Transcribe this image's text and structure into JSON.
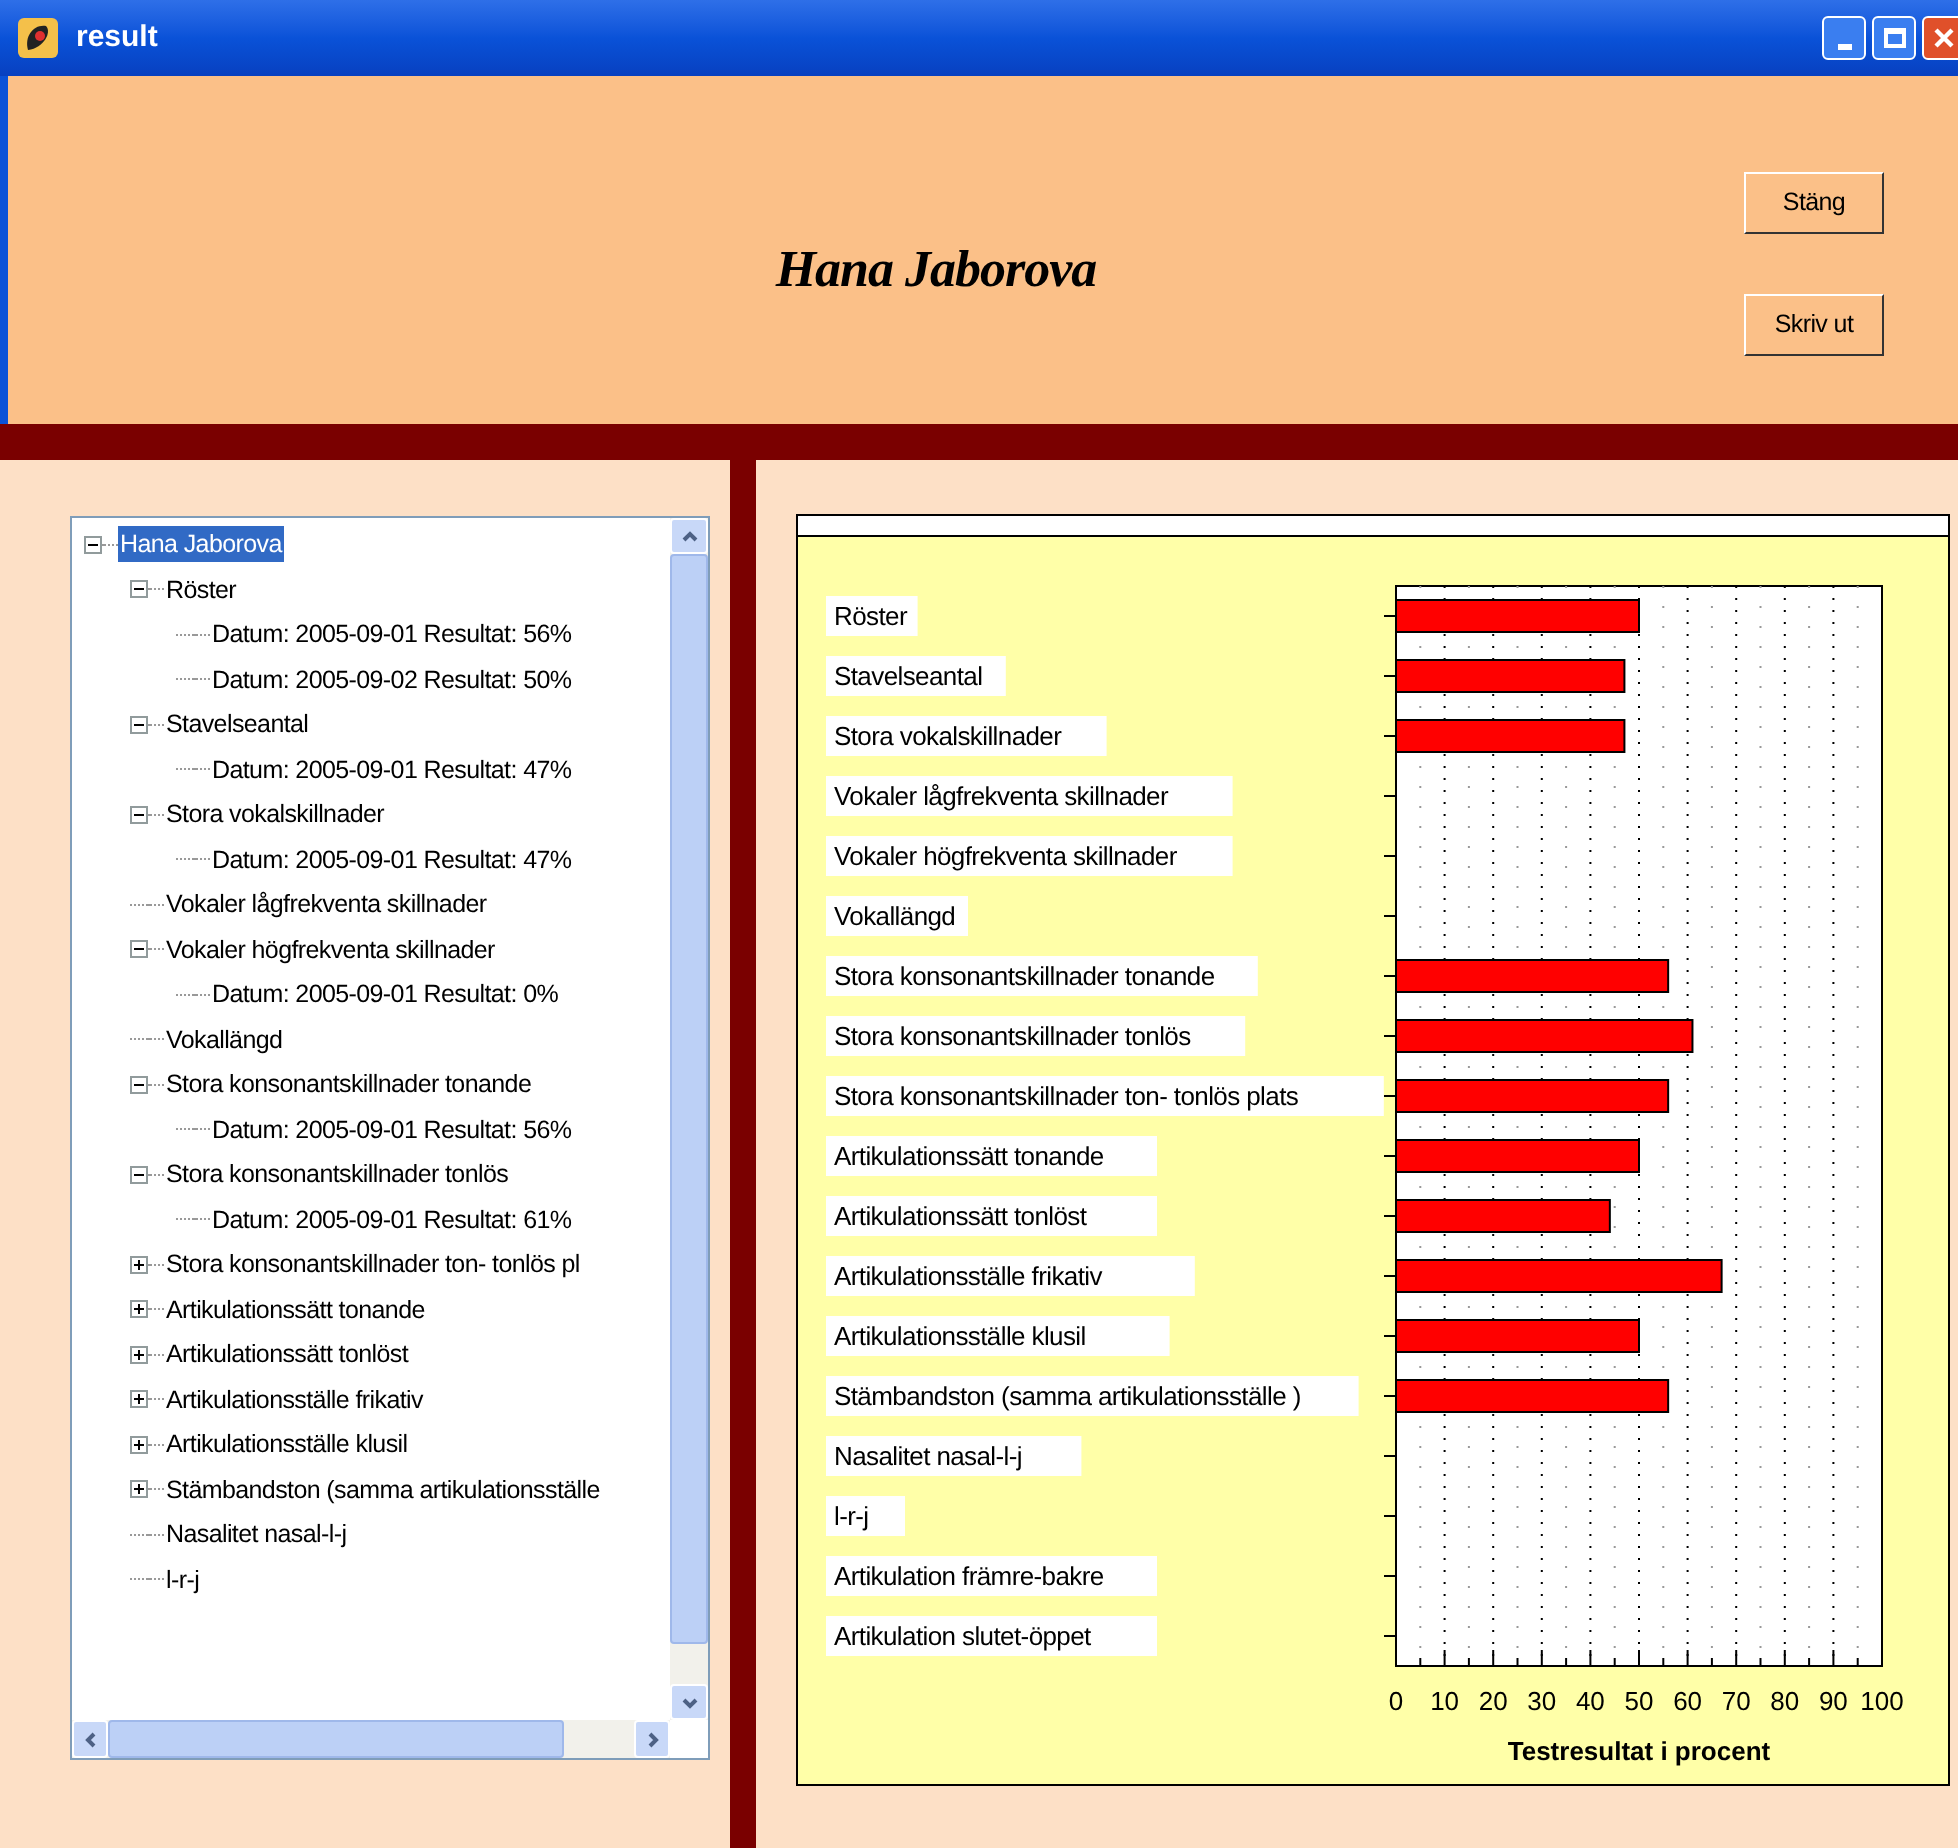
{
  "window": {
    "title": "result"
  },
  "header": {
    "name": "Hana Jaborova",
    "buttons": [
      "Stäng",
      "Skriv ut"
    ]
  },
  "tree": [
    {
      "label": "Hana Jaborova",
      "selected": true,
      "expanded": true,
      "children": [
        {
          "label": "Röster",
          "selected": false,
          "expanded": true,
          "children": [
            {
              "label": "Datum: 2005-09-01 Resultat: 56%",
              "selected": false
            },
            {
              "label": "Datum: 2005-09-02 Resultat: 50%",
              "selected": false
            }
          ]
        },
        {
          "label": "Stavelseantal",
          "selected": false,
          "expanded": true,
          "children": [
            {
              "label": "Datum: 2005-09-01 Resultat: 47%",
              "selected": false
            }
          ]
        },
        {
          "label": "Stora vokalskillnader",
          "selected": false,
          "expanded": true,
          "children": [
            {
              "label": "Datum: 2005-09-01 Resultat: 47%",
              "selected": false
            }
          ]
        },
        {
          "label": "Vokaler lågfrekventa skillnader",
          "selected": false
        },
        {
          "label": "Vokaler högfrekventa skillnader",
          "selected": false,
          "expanded": true,
          "children": [
            {
              "label": "Datum: 2005-09-01 Resultat: 0%",
              "selected": false
            }
          ]
        },
        {
          "label": "Vokallängd",
          "selected": false
        },
        {
          "label": "Stora konsonantskillnader tonande",
          "selected": false,
          "expanded": true,
          "children": [
            {
              "label": "Datum: 2005-09-01 Resultat: 56%",
              "selected": false
            }
          ]
        },
        {
          "label": "Stora konsonantskillnader tonlös",
          "selected": false,
          "expanded": true,
          "children": [
            {
              "label": "Datum: 2005-09-01 Resultat: 61%",
              "selected": false
            }
          ]
        },
        {
          "label": "Stora konsonantskillnader ton- tonlös pl",
          "selected": false,
          "expanded": false
        },
        {
          "label": "Artikulationssätt tonande",
          "selected": false,
          "expanded": false
        },
        {
          "label": "Artikulationssätt tonlöst",
          "selected": false,
          "expanded": false
        },
        {
          "label": "Artikulationsställe frikativ",
          "selected": false,
          "expanded": false
        },
        {
          "label": "Artikulationsställe klusil",
          "selected": false,
          "expanded": false
        },
        {
          "label": "Stämbandston (samma artikulationsställe",
          "selected": false,
          "expanded": false
        },
        {
          "label": "Nasalitet nasal-l-j",
          "selected": false
        },
        {
          "label": "l-r-j",
          "selected": false
        }
      ]
    }
  ],
  "chart": {
    "chart_data": {
      "type": "bar",
      "orientation": "horizontal",
      "xlabel": "Testresultat i procent",
      "categories": [
        "Röster",
        "Stavelseantal",
        "Stora vokalskillnader",
        "Vokaler lågfrekventa skillnader",
        "Vokaler högfrekventa skillnader",
        "Vokallängd",
        "Stora konsonantskillnader tonande",
        "Stora konsonantskillnader tonlös",
        "Stora konsonantskillnader ton- tonlös plats",
        "Artikulationssätt tonande",
        "Artikulationssätt tonlöst",
        "Artikulationsställe frikativ",
        "Artikulationsställe klusil",
        "Stämbandston (samma artikulationsställe )",
        "Nasalitet nasal-l-j",
        "l-r-j",
        "Artikulation främre-bakre",
        "Artikulation slutet-öppet"
      ],
      "series": [
        {
          "color": "#ff0000",
          "values": [
            50,
            47,
            47,
            null,
            0,
            null,
            56,
            61,
            56,
            50,
            44,
            67,
            50,
            56,
            null,
            null,
            null,
            null
          ]
        }
      ],
      "grid": true,
      "xlim": [
        0,
        100
      ],
      "xticks": [
        0,
        10,
        20,
        30,
        40,
        50,
        60,
        70,
        80,
        90,
        100
      ]
    }
  }
}
